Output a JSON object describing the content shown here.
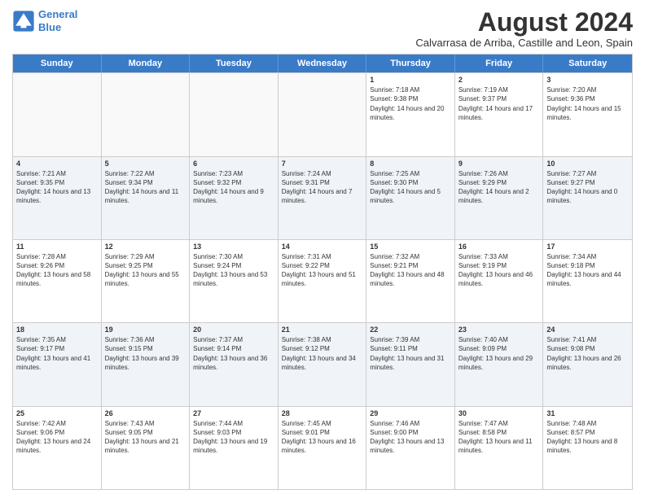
{
  "logo": {
    "line1": "General",
    "line2": "Blue"
  },
  "title": "August 2024",
  "subtitle": "Calvarrasa de Arriba, Castille and Leon, Spain",
  "days_of_week": [
    "Sunday",
    "Monday",
    "Tuesday",
    "Wednesday",
    "Thursday",
    "Friday",
    "Saturday"
  ],
  "weeks": [
    [
      {
        "day": "",
        "info": ""
      },
      {
        "day": "",
        "info": ""
      },
      {
        "day": "",
        "info": ""
      },
      {
        "day": "",
        "info": ""
      },
      {
        "day": "1",
        "info": "Sunrise: 7:18 AM\nSunset: 9:38 PM\nDaylight: 14 hours and 20 minutes."
      },
      {
        "day": "2",
        "info": "Sunrise: 7:19 AM\nSunset: 9:37 PM\nDaylight: 14 hours and 17 minutes."
      },
      {
        "day": "3",
        "info": "Sunrise: 7:20 AM\nSunset: 9:36 PM\nDaylight: 14 hours and 15 minutes."
      }
    ],
    [
      {
        "day": "4",
        "info": "Sunrise: 7:21 AM\nSunset: 9:35 PM\nDaylight: 14 hours and 13 minutes."
      },
      {
        "day": "5",
        "info": "Sunrise: 7:22 AM\nSunset: 9:34 PM\nDaylight: 14 hours and 11 minutes."
      },
      {
        "day": "6",
        "info": "Sunrise: 7:23 AM\nSunset: 9:32 PM\nDaylight: 14 hours and 9 minutes."
      },
      {
        "day": "7",
        "info": "Sunrise: 7:24 AM\nSunset: 9:31 PM\nDaylight: 14 hours and 7 minutes."
      },
      {
        "day": "8",
        "info": "Sunrise: 7:25 AM\nSunset: 9:30 PM\nDaylight: 14 hours and 5 minutes."
      },
      {
        "day": "9",
        "info": "Sunrise: 7:26 AM\nSunset: 9:29 PM\nDaylight: 14 hours and 2 minutes."
      },
      {
        "day": "10",
        "info": "Sunrise: 7:27 AM\nSunset: 9:27 PM\nDaylight: 14 hours and 0 minutes."
      }
    ],
    [
      {
        "day": "11",
        "info": "Sunrise: 7:28 AM\nSunset: 9:26 PM\nDaylight: 13 hours and 58 minutes."
      },
      {
        "day": "12",
        "info": "Sunrise: 7:29 AM\nSunset: 9:25 PM\nDaylight: 13 hours and 55 minutes."
      },
      {
        "day": "13",
        "info": "Sunrise: 7:30 AM\nSunset: 9:24 PM\nDaylight: 13 hours and 53 minutes."
      },
      {
        "day": "14",
        "info": "Sunrise: 7:31 AM\nSunset: 9:22 PM\nDaylight: 13 hours and 51 minutes."
      },
      {
        "day": "15",
        "info": "Sunrise: 7:32 AM\nSunset: 9:21 PM\nDaylight: 13 hours and 48 minutes."
      },
      {
        "day": "16",
        "info": "Sunrise: 7:33 AM\nSunset: 9:19 PM\nDaylight: 13 hours and 46 minutes."
      },
      {
        "day": "17",
        "info": "Sunrise: 7:34 AM\nSunset: 9:18 PM\nDaylight: 13 hours and 44 minutes."
      }
    ],
    [
      {
        "day": "18",
        "info": "Sunrise: 7:35 AM\nSunset: 9:17 PM\nDaylight: 13 hours and 41 minutes."
      },
      {
        "day": "19",
        "info": "Sunrise: 7:36 AM\nSunset: 9:15 PM\nDaylight: 13 hours and 39 minutes."
      },
      {
        "day": "20",
        "info": "Sunrise: 7:37 AM\nSunset: 9:14 PM\nDaylight: 13 hours and 36 minutes."
      },
      {
        "day": "21",
        "info": "Sunrise: 7:38 AM\nSunset: 9:12 PM\nDaylight: 13 hours and 34 minutes."
      },
      {
        "day": "22",
        "info": "Sunrise: 7:39 AM\nSunset: 9:11 PM\nDaylight: 13 hours and 31 minutes."
      },
      {
        "day": "23",
        "info": "Sunrise: 7:40 AM\nSunset: 9:09 PM\nDaylight: 13 hours and 29 minutes."
      },
      {
        "day": "24",
        "info": "Sunrise: 7:41 AM\nSunset: 9:08 PM\nDaylight: 13 hours and 26 minutes."
      }
    ],
    [
      {
        "day": "25",
        "info": "Sunrise: 7:42 AM\nSunset: 9:06 PM\nDaylight: 13 hours and 24 minutes."
      },
      {
        "day": "26",
        "info": "Sunrise: 7:43 AM\nSunset: 9:05 PM\nDaylight: 13 hours and 21 minutes."
      },
      {
        "day": "27",
        "info": "Sunrise: 7:44 AM\nSunset: 9:03 PM\nDaylight: 13 hours and 19 minutes."
      },
      {
        "day": "28",
        "info": "Sunrise: 7:45 AM\nSunset: 9:01 PM\nDaylight: 13 hours and 16 minutes."
      },
      {
        "day": "29",
        "info": "Sunrise: 7:46 AM\nSunset: 9:00 PM\nDaylight: 13 hours and 13 minutes."
      },
      {
        "day": "30",
        "info": "Sunrise: 7:47 AM\nSunset: 8:58 PM\nDaylight: 13 hours and 11 minutes."
      },
      {
        "day": "31",
        "info": "Sunrise: 7:48 AM\nSunset: 8:57 PM\nDaylight: 13 hours and 8 minutes."
      }
    ]
  ]
}
